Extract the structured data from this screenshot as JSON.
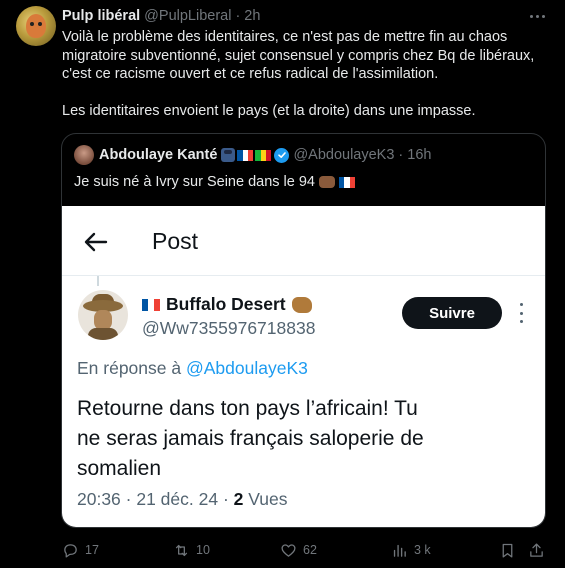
{
  "tweet": {
    "display_name": "Pulp libéral",
    "handle": "@PulpLiberal",
    "separator": "·",
    "time": "2h",
    "paragraph1": "Voilà le problème des identitaires, ce n'est pas de mettre fin au chaos\nmigratoire subventionné, sujet consensuel y compris chez Bq de libéraux,\nc'est ce racisme ouvert et ce refus radical de l'assimilation.",
    "paragraph2": "Les identitaires envoient le pays (et la droite) dans une impasse."
  },
  "quote": {
    "display_name": "Abdoulaye Kanté",
    "handle": "@AbdoulayeK3",
    "separator": "·",
    "time": "16h",
    "text": "Je suis né à Ivry sur Seine dans le 94"
  },
  "screenshot": {
    "title": "Post",
    "display_name": "Buffalo Desert",
    "handle": "@Ww7355976718838",
    "follow_label": "Suivre",
    "reply_prefix": "En réponse à",
    "reply_mention": "@AbdoulayeK3",
    "text": "Retourne dans ton pays l’africain! Tu\nne seras jamais français saloperie de\nsomalien",
    "meta_date": "20:36 · 21 déc. 24 ·",
    "meta_views_count": "2",
    "meta_views_label": "Vues"
  },
  "actions": {
    "replies": "17",
    "reposts": "10",
    "likes": "62",
    "views": "3 k"
  },
  "icons": {
    "reply": "reply-icon",
    "repost": "repost-icon",
    "like": "heart-icon",
    "views": "views-icon",
    "bookmark": "bookmark-icon",
    "share": "share-icon",
    "more": "more-icon",
    "verified": "verified-badge-icon",
    "back": "back-arrow-icon"
  },
  "colors": {
    "background": "#000000",
    "text": "#e7e9ea",
    "muted": "#71767b",
    "accent": "#1d9bf0",
    "border": "#2f3336"
  }
}
